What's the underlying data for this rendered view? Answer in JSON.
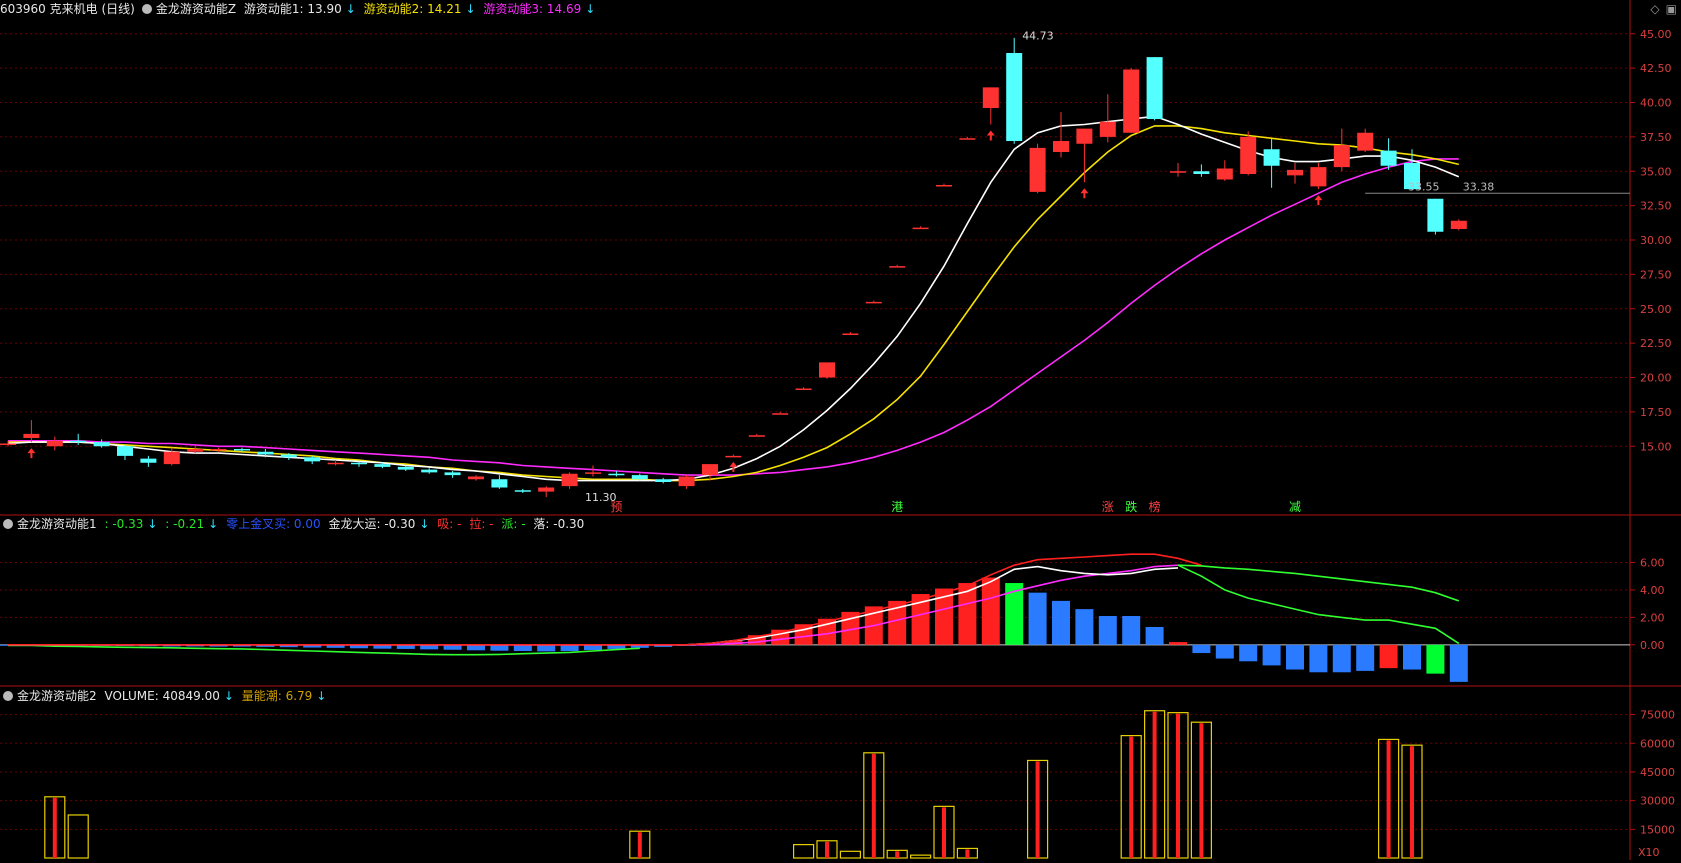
{
  "header": {
    "stock": "603960 克来机电 (日线)",
    "main_indicator": "金龙游资动能Z",
    "line1": "游资动能1: 13.90",
    "line2": "游资动能2: 14.21",
    "line3": "游资动能3: 14.69"
  },
  "sub1_header": {
    "name": "金龙游资动能1",
    "v1": ": -0.33",
    "v2": ": -0.21",
    "v3": "零上金叉买: 0.00",
    "v4": "金龙大运: -0.30",
    "v5": "吸: -",
    "v6": "拉: -",
    "v7": "派: -",
    "v8": "落: -0.30"
  },
  "sub2_header": {
    "name": "金龙游资动能2",
    "volume": "VOLUME: 40849.00",
    "energy": "量能潮: 6.79"
  },
  "colors": {
    "up": "#ff3232",
    "down": "#54ffff",
    "ma1": "#ffffff",
    "ma2": "#f5e100",
    "ma3": "#ff2bff",
    "axis": "#b01010",
    "grid": "#6a0000",
    "label": "#d84040"
  },
  "chart_data": [
    {
      "type": "candlestick",
      "title": "游资动能",
      "y_ticks": [
        "45.00",
        "42.50",
        "40.00",
        "37.50",
        "35.00",
        "32.50",
        "30.00",
        "27.50",
        "25.00",
        "22.50",
        "20.00",
        "17.50",
        "15.00"
      ],
      "ylim": [
        10,
        46
      ],
      "candles": [
        {
          "o": 15.2,
          "h": 15.4,
          "l": 15.0,
          "c": 15.2
        },
        {
          "o": 15.6,
          "h": 16.9,
          "l": 15.3,
          "c": 15.9
        },
        {
          "o": 15.0,
          "h": 15.7,
          "l": 14.7,
          "c": 15.4
        },
        {
          "o": 15.4,
          "h": 15.9,
          "l": 15.1,
          "c": 15.3
        },
        {
          "o": 15.3,
          "h": 15.5,
          "l": 14.9,
          "c": 15.0
        },
        {
          "o": 15.0,
          "h": 15.1,
          "l": 14.0,
          "c": 14.3
        },
        {
          "o": 14.1,
          "h": 14.3,
          "l": 13.5,
          "c": 13.8
        },
        {
          "o": 13.7,
          "h": 14.9,
          "l": 13.6,
          "c": 14.6
        },
        {
          "o": 14.6,
          "h": 15.0,
          "l": 14.5,
          "c": 14.8
        },
        {
          "o": 14.7,
          "h": 14.9,
          "l": 14.6,
          "c": 14.8
        },
        {
          "o": 14.8,
          "h": 14.9,
          "l": 14.6,
          "c": 14.7
        },
        {
          "o": 14.6,
          "h": 14.8,
          "l": 14.2,
          "c": 14.4
        },
        {
          "o": 14.4,
          "h": 14.5,
          "l": 14.0,
          "c": 14.2
        },
        {
          "o": 14.2,
          "h": 14.3,
          "l": 13.7,
          "c": 13.9
        },
        {
          "o": 13.8,
          "h": 14.0,
          "l": 13.6,
          "c": 13.8
        },
        {
          "o": 13.8,
          "h": 13.9,
          "l": 13.5,
          "c": 13.7
        },
        {
          "o": 13.7,
          "h": 13.8,
          "l": 13.4,
          "c": 13.5
        },
        {
          "o": 13.5,
          "h": 13.6,
          "l": 13.2,
          "c": 13.3
        },
        {
          "o": 13.3,
          "h": 13.4,
          "l": 13.0,
          "c": 13.1
        },
        {
          "o": 13.1,
          "h": 13.2,
          "l": 12.7,
          "c": 12.9
        },
        {
          "o": 12.6,
          "h": 12.9,
          "l": 12.5,
          "c": 12.8
        },
        {
          "o": 12.6,
          "h": 12.9,
          "l": 11.9,
          "c": 12.0
        },
        {
          "o": 11.8,
          "h": 11.9,
          "l": 11.6,
          "c": 11.7
        },
        {
          "o": 11.7,
          "h": 12.1,
          "l": 11.3,
          "c": 12.0
        },
        {
          "o": 12.1,
          "h": 13.1,
          "l": 11.9,
          "c": 13.0
        },
        {
          "o": 13.0,
          "h": 13.6,
          "l": 12.8,
          "c": 13.1
        },
        {
          "o": 13.0,
          "h": 13.2,
          "l": 12.8,
          "c": 12.9
        },
        {
          "o": 12.9,
          "h": 13.0,
          "l": 12.5,
          "c": 12.6
        },
        {
          "o": 12.6,
          "h": 12.7,
          "l": 12.3,
          "c": 12.4
        },
        {
          "o": 12.1,
          "h": 12.9,
          "l": 11.9,
          "c": 12.8
        },
        {
          "o": 12.9,
          "h": 13.7,
          "l": 12.5,
          "c": 13.7
        },
        {
          "o": 14.3,
          "h": 14.4,
          "l": 14.3,
          "c": 14.3
        },
        {
          "o": 15.8,
          "h": 15.9,
          "l": 15.8,
          "c": 15.8
        },
        {
          "o": 17.4,
          "h": 17.5,
          "l": 17.4,
          "c": 17.4
        },
        {
          "o": 19.2,
          "h": 19.3,
          "l": 19.2,
          "c": 19.2
        },
        {
          "o": 20.0,
          "h": 21.1,
          "l": 19.9,
          "c": 21.1
        },
        {
          "o": 23.2,
          "h": 23.3,
          "l": 23.2,
          "c": 23.2
        },
        {
          "o": 25.5,
          "h": 25.6,
          "l": 25.5,
          "c": 25.5
        },
        {
          "o": 28.1,
          "h": 28.2,
          "l": 28.1,
          "c": 28.1
        },
        {
          "o": 30.9,
          "h": 31.0,
          "l": 30.9,
          "c": 30.9
        },
        {
          "o": 34.0,
          "h": 34.1,
          "l": 34.0,
          "c": 34.0
        },
        {
          "o": 37.4,
          "h": 37.5,
          "l": 37.4,
          "c": 37.4
        },
        {
          "o": 39.6,
          "h": 41.1,
          "l": 38.4,
          "c": 41.1
        },
        {
          "o": 43.6,
          "h": 44.7,
          "l": 37.0,
          "c": 37.2
        },
        {
          "o": 33.5,
          "h": 37.0,
          "l": 33.4,
          "c": 36.7
        },
        {
          "o": 36.4,
          "h": 39.3,
          "l": 36.0,
          "c": 37.2
        },
        {
          "o": 37.0,
          "h": 38.1,
          "l": 34.2,
          "c": 38.1
        },
        {
          "o": 37.5,
          "h": 40.6,
          "l": 37.1,
          "c": 38.6
        },
        {
          "o": 37.8,
          "h": 42.5,
          "l": 37.8,
          "c": 42.4
        },
        {
          "o": 43.3,
          "h": 43.3,
          "l": 38.7,
          "c": 38.8
        },
        {
          "o": 35.0,
          "h": 35.6,
          "l": 34.6,
          "c": 35.0
        },
        {
          "o": 35.0,
          "h": 35.5,
          "l": 34.6,
          "c": 34.8
        },
        {
          "o": 34.4,
          "h": 35.8,
          "l": 34.3,
          "c": 35.2
        },
        {
          "o": 34.8,
          "h": 37.9,
          "l": 34.7,
          "c": 37.5
        },
        {
          "o": 36.6,
          "h": 37.4,
          "l": 33.8,
          "c": 35.4
        },
        {
          "o": 34.7,
          "h": 35.6,
          "l": 34.1,
          "c": 35.1
        },
        {
          "o": 33.9,
          "h": 35.6,
          "l": 33.7,
          "c": 35.3
        },
        {
          "o": 35.3,
          "h": 38.1,
          "l": 35.0,
          "c": 36.9
        },
        {
          "o": 36.5,
          "h": 38.1,
          "l": 36.4,
          "c": 37.8
        },
        {
          "o": 36.5,
          "h": 37.4,
          "l": 35.1,
          "c": 35.4
        },
        {
          "o": 35.6,
          "h": 36.6,
          "l": 33.6,
          "c": 33.7
        },
        {
          "o": 33.0,
          "h": 33.0,
          "l": 30.4,
          "c": 30.6
        },
        {
          "o": 30.8,
          "h": 31.5,
          "l": 30.7,
          "c": 31.4
        }
      ],
      "ma1": [
        15.2,
        15.3,
        15.3,
        15.3,
        15.2,
        15.0,
        14.8,
        14.6,
        14.5,
        14.5,
        14.4,
        14.3,
        14.2,
        14.1,
        14.0,
        13.9,
        13.8,
        13.6,
        13.5,
        13.3,
        13.2,
        13.0,
        12.8,
        12.6,
        12.5,
        12.5,
        12.5,
        12.5,
        12.5,
        12.6,
        12.9,
        13.4,
        14.1,
        15.0,
        16.2,
        17.6,
        19.2,
        21.0,
        23.0,
        25.4,
        28.1,
        31.2,
        34.2,
        36.6,
        37.8,
        38.3,
        38.4,
        38.6,
        38.8,
        39.0,
        38.4,
        37.7,
        37.1,
        36.5,
        36.0,
        35.7,
        35.7,
        35.9,
        36.1,
        36.1,
        35.8,
        35.3,
        34.6
      ],
      "ma2": [
        15.3,
        15.3,
        15.3,
        15.3,
        15.2,
        15.1,
        15.0,
        14.9,
        14.8,
        14.7,
        14.6,
        14.5,
        14.4,
        14.3,
        14.1,
        14.0,
        13.8,
        13.7,
        13.5,
        13.4,
        13.2,
        13.1,
        12.9,
        12.8,
        12.7,
        12.6,
        12.6,
        12.6,
        12.5,
        12.5,
        12.6,
        12.8,
        13.1,
        13.6,
        14.2,
        14.9,
        15.9,
        17.0,
        18.4,
        20.1,
        22.4,
        24.8,
        27.2,
        29.5,
        31.5,
        33.2,
        34.9,
        36.4,
        37.6,
        38.3,
        38.3,
        38.1,
        37.8,
        37.6,
        37.4,
        37.2,
        37.0,
        36.9,
        36.7,
        36.4,
        36.2,
        35.9,
        35.5
      ],
      "ma3": [
        15.4,
        15.4,
        15.4,
        15.4,
        15.3,
        15.3,
        15.2,
        15.2,
        15.1,
        15.0,
        15.0,
        14.9,
        14.8,
        14.7,
        14.6,
        14.5,
        14.4,
        14.3,
        14.2,
        14.0,
        13.9,
        13.8,
        13.6,
        13.5,
        13.4,
        13.3,
        13.2,
        13.1,
        13.0,
        12.9,
        12.9,
        12.9,
        13.0,
        13.1,
        13.3,
        13.5,
        13.8,
        14.2,
        14.7,
        15.3,
        16.0,
        16.9,
        17.9,
        19.1,
        20.3,
        21.5,
        22.7,
        24.0,
        25.4,
        26.7,
        27.9,
        29.0,
        30.0,
        30.9,
        31.8,
        32.6,
        33.4,
        34.2,
        34.8,
        35.3,
        35.7,
        35.9,
        35.9
      ],
      "price_labels": [
        "44.73",
        "11.30",
        "33.55",
        "33.38"
      ],
      "signals": [
        "预",
        "港",
        "涨",
        "跌",
        "榜",
        "减"
      ]
    },
    {
      "type": "bar",
      "title": "金龙游资动能1",
      "y_ticks": [
        "6.00",
        "4.00",
        "2.00",
        "0.00"
      ],
      "ylim": [
        -3,
        8
      ],
      "macd": [
        -0.05,
        -0.05,
        -0.05,
        -0.05,
        -0.06,
        -0.08,
        -0.1,
        -0.12,
        -0.12,
        -0.13,
        -0.13,
        -0.15,
        -0.17,
        -0.2,
        -0.22,
        -0.25,
        -0.28,
        -0.3,
        -0.33,
        -0.36,
        -0.4,
        -0.43,
        -0.45,
        -0.48,
        -0.45,
        -0.38,
        -0.3,
        -0.22,
        -0.15,
        -0.05,
        0.05,
        0.3,
        0.7,
        1.1,
        1.5,
        1.9,
        2.4,
        2.8,
        3.2,
        3.7,
        4.1,
        4.5,
        4.9,
        4.5,
        3.8,
        3.2,
        2.6,
        2.1,
        2.1,
        1.3,
        0.2,
        -0.6,
        -1.0,
        -1.2,
        -1.5,
        -1.8,
        -2.0,
        -2.0,
        -1.9,
        -1.7,
        -1.8,
        -2.1,
        -2.7
      ],
      "line_red": [
        0,
        0,
        0,
        0,
        0,
        0,
        0,
        0,
        0,
        0,
        0,
        0,
        0,
        0,
        0,
        0,
        0,
        0,
        0,
        0,
        0,
        0,
        0,
        0,
        0,
        0,
        0,
        0,
        0,
        0,
        0.1,
        0.3,
        0.6,
        0.9,
        1.3,
        1.7,
        2.1,
        2.5,
        2.9,
        3.3,
        3.8,
        4.3,
        5.1,
        5.8,
        6.2,
        6.3,
        6.4,
        6.5,
        6.6,
        6.6,
        6.3,
        5.8
      ],
      "line_white": [
        0,
        0,
        0,
        0,
        0,
        0,
        0,
        0,
        0,
        0,
        0,
        0,
        0,
        0,
        0,
        0,
        0,
        0,
        0,
        0,
        0,
        0,
        0,
        0,
        0,
        0,
        0,
        0,
        0,
        0,
        0.1,
        0.3,
        0.5,
        0.8,
        1.1,
        1.5,
        1.9,
        2.3,
        2.7,
        3.1,
        3.5,
        3.9,
        4.6,
        5.5,
        5.7,
        5.4,
        5.2,
        5.1,
        5.2,
        5.5,
        5.6
      ],
      "line_mag": [
        0,
        0,
        0,
        0,
        0,
        0,
        0,
        0,
        0,
        0,
        0,
        0,
        0,
        0,
        0,
        0,
        0,
        0,
        0,
        0,
        0,
        0,
        0,
        0,
        0,
        0,
        0,
        0,
        0,
        0,
        0,
        0.1,
        0.2,
        0.4,
        0.6,
        0.8,
        1.1,
        1.4,
        1.8,
        2.2,
        2.6,
        3.0,
        3.4,
        3.9,
        4.3,
        4.7,
        5.0,
        5.2,
        5.4,
        5.7,
        5.8
      ],
      "line_green1": [
        -0.05,
        -0.05,
        -0.1,
        -0.12,
        -0.15,
        -0.18,
        -0.2,
        -0.22,
        -0.25,
        -0.28,
        -0.3,
        -0.35,
        -0.4,
        -0.45,
        -0.5,
        -0.55,
        -0.6,
        -0.65,
        -0.7,
        -0.72,
        -0.72,
        -0.7,
        -0.65,
        -0.6,
        -0.55,
        -0.45,
        -0.35,
        -0.25
      ],
      "line_green2_idx": [
        50,
        51,
        52,
        53,
        54,
        55,
        56,
        57,
        58,
        59,
        60,
        61,
        62
      ],
      "line_green2": [
        5.8,
        5.75,
        5.6,
        5.5,
        5.35,
        5.2,
        5.0,
        4.8,
        4.6,
        4.4,
        4.2,
        3.8,
        3.2
      ],
      "line_green3": [
        5.8,
        5.0,
        4.0,
        3.4,
        3.0,
        2.6,
        2.2,
        2.0,
        1.8,
        1.8,
        1.5,
        1.2,
        0.1
      ]
    },
    {
      "type": "bar",
      "title": "金龙游资动能2",
      "y_ticks": [
        "75000",
        "60000",
        "45000",
        "30000",
        "15000"
      ],
      "ylim": [
        0,
        80000
      ],
      "scale_label": "X10",
      "volume_bars": [
        {
          "i": 2,
          "v": 32000,
          "c": "r"
        },
        {
          "i": 3,
          "v": 22500,
          "c": "o"
        },
        {
          "i": 27,
          "v": 14000,
          "c": "r"
        },
        {
          "i": 34,
          "v": 7000,
          "c": "o"
        },
        {
          "i": 35,
          "v": 9000,
          "c": "r"
        },
        {
          "i": 36,
          "v": 3500,
          "c": "o"
        },
        {
          "i": 37,
          "v": 55000,
          "c": "r"
        },
        {
          "i": 38,
          "v": 4000,
          "c": "r"
        },
        {
          "i": 39,
          "v": 1500,
          "c": "o"
        },
        {
          "i": 40,
          "v": 27000,
          "c": "r"
        },
        {
          "i": 41,
          "v": 5000,
          "c": "r"
        },
        {
          "i": 44,
          "v": 51000,
          "c": "r"
        },
        {
          "i": 48,
          "v": 64000,
          "c": "r"
        },
        {
          "i": 49,
          "v": 77000,
          "c": "r"
        },
        {
          "i": 50,
          "v": 76000,
          "c": "r"
        },
        {
          "i": 51,
          "v": 71000,
          "c": "r"
        },
        {
          "i": 59,
          "v": 62000,
          "c": "r"
        },
        {
          "i": 60,
          "v": 59000,
          "c": "r"
        }
      ]
    }
  ]
}
